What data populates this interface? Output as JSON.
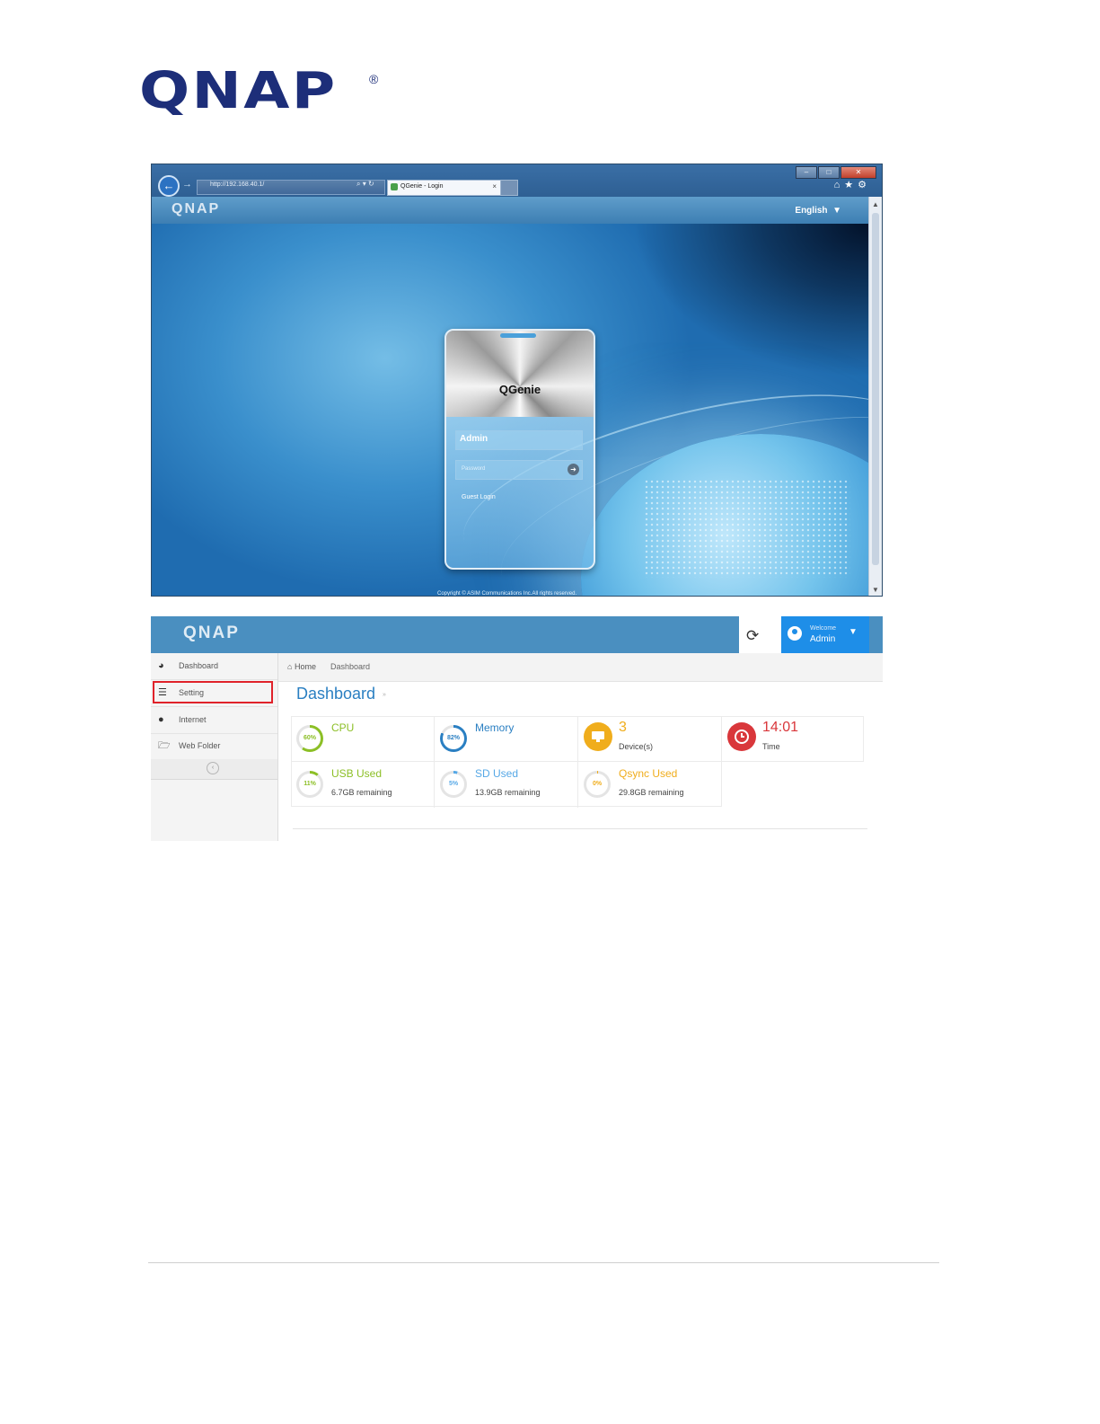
{
  "document": {
    "logo_text": "QNAP",
    "registered_mark": "®",
    "brand_color": "#1d2e79"
  },
  "login_browser": {
    "address": "http://192.168.40.1/",
    "tab_title": "QGenie - Login",
    "header_logo": "QNAP",
    "language": "English",
    "login_card": {
      "device_name": "QGenie",
      "username_value": "Admin",
      "password_placeholder": "Password",
      "guest_login": "Guest Login"
    },
    "copyright": "Copyright © ASIM Communications Inc.All rights reserved."
  },
  "dashboard": {
    "header_logo": "QNAP",
    "welcome_label": "Welcome",
    "user_name": "Admin",
    "accent": "#1e8ee8",
    "sidebar": [
      {
        "label": "Dashboard",
        "icon": "dashboard-icon"
      },
      {
        "label": "Setting",
        "icon": "list-icon"
      },
      {
        "label": "Internet",
        "icon": "globe-icon"
      },
      {
        "label": "Web Folder",
        "icon": "folder-open-icon"
      }
    ],
    "breadcrumb": {
      "home": "Home",
      "current": "Dashboard"
    },
    "page_title": "Dashboard",
    "metrics": {
      "cpu": {
        "value": "60%",
        "fraction": 0.6,
        "label": "CPU",
        "color": "#8cbf26"
      },
      "memory": {
        "value": "82%",
        "fraction": 0.82,
        "label": "Memory",
        "color": "#2a7fc2"
      },
      "devices": {
        "value": "3",
        "label": "Device(s)",
        "color": "#f0ad1c"
      },
      "time": {
        "value": "14:01",
        "label": "Time",
        "color": "#d9373b"
      },
      "usb": {
        "value": "11%",
        "fraction": 0.11,
        "label": "USB Used",
        "remaining": "6.7GB remaining",
        "color": "#8cbf26"
      },
      "sd": {
        "value": "5%",
        "fraction": 0.05,
        "label": "SD Used",
        "remaining": "13.9GB remaining",
        "color": "#56a8e6"
      },
      "qsync": {
        "value": "0%",
        "fraction": 0.0,
        "label": "Qsync Used",
        "remaining": "29.8GB remaining",
        "color": "#f0ad1c"
      }
    }
  }
}
